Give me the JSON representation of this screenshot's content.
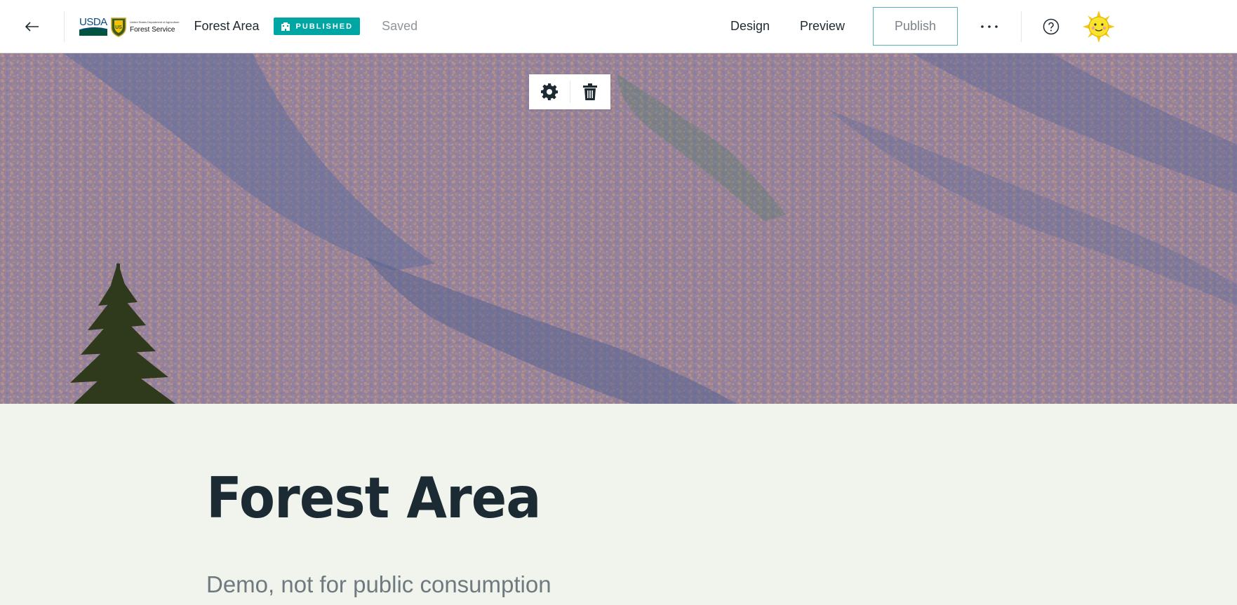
{
  "header": {
    "back_icon": "arrow-left-icon",
    "logo": {
      "usda": "USDA",
      "dept": "United States Department of Agriculture",
      "service": "Forest Service"
    },
    "story_title": "Forest Area",
    "status_badge": "PUBLISHED",
    "save_status": "Saved",
    "nav": {
      "design": "Design",
      "preview": "Preview",
      "publish": "Publish"
    },
    "more_icon": "ellipsis-icon",
    "help_icon": "question-circle-icon"
  },
  "block_toolbar": {
    "settings_icon": "gear-icon",
    "delete_icon": "trash-icon"
  },
  "content": {
    "title": "Forest Area",
    "subtitle": "Demo, not for public consumption"
  },
  "colors": {
    "accent": "#00a6a4",
    "title": "#1c2a33",
    "subtitle": "#6f7a80",
    "background": "#f1f4ec"
  }
}
